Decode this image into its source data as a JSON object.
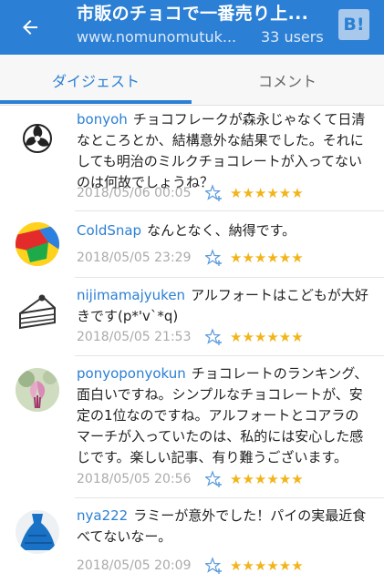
{
  "appbar": {
    "title": "市販のチョコで一番売り上...",
    "url": "www.nomunomutuk...",
    "users": "33 users",
    "hatena_label": "B!"
  },
  "tabs": {
    "digest": "ダイジェスト",
    "comment": "コメント"
  },
  "comments": [
    {
      "user": "bonyoh",
      "text": "チョコフレークが森永じゃなくて日清なところとか、結構意外な結果でした。それにしても明治のミルクチョコレートが入ってないのは何故でしょうね？",
      "date": "2018/05/06 00:05",
      "stars": "★★★★★★"
    },
    {
      "user": "ColdSnap",
      "text": "なんとなく、納得です。",
      "date": "2018/05/05 23:29",
      "stars": "★★★★★★"
    },
    {
      "user": "nijimamajyuken",
      "text": "アルフォートはこどもが大好きです(p*'v`*q)",
      "date": "2018/05/05 21:53",
      "stars": "★★★★★★"
    },
    {
      "user": "ponyoponyokun",
      "text": "チョコレートのランキング、面白いですね。シンプルなチョコレートが、安定の1位なのですね。アルフォートとコアラのマーチが入っていたのは、私的には安心した感じです。楽しい記事、有り難うございます。",
      "date": "2018/05/05 20:56",
      "stars": "★★★★★★"
    },
    {
      "user": "nya222",
      "text": "ラミーが意外でした！パイの実最近食べてないなー。",
      "date": "2018/05/05 20:09",
      "stars": "★★★★★★"
    }
  ]
}
